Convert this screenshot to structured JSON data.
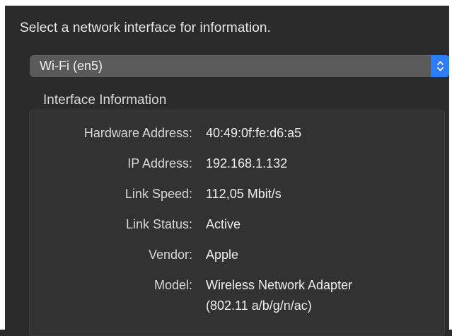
{
  "prompt": "Select a network interface for information.",
  "interface_popup": {
    "selected": "Wi-Fi (en5)",
    "stepper_icon": "up-down-chevron-icon"
  },
  "section_title": "Interface Information",
  "info": {
    "hardware_address": {
      "label": "Hardware Address:",
      "value": "40:49:0f:fe:d6:a5"
    },
    "ip_address": {
      "label": "IP Address:",
      "value": "192.168.1.132"
    },
    "link_speed": {
      "label": "Link Speed:",
      "value": "112,05 Mbit/s"
    },
    "link_status": {
      "label": "Link Status:",
      "value": "Active"
    },
    "vendor": {
      "label": "Vendor:",
      "value": "Apple"
    },
    "model": {
      "label": "Model:",
      "value_line1": "Wireless Network Adapter",
      "value_line2": "(802.11 a/b/g/n/ac)"
    }
  },
  "colors": {
    "background": "#2b2b2b",
    "popup": "#5a5a5a",
    "accent": "#2f7cf6"
  }
}
